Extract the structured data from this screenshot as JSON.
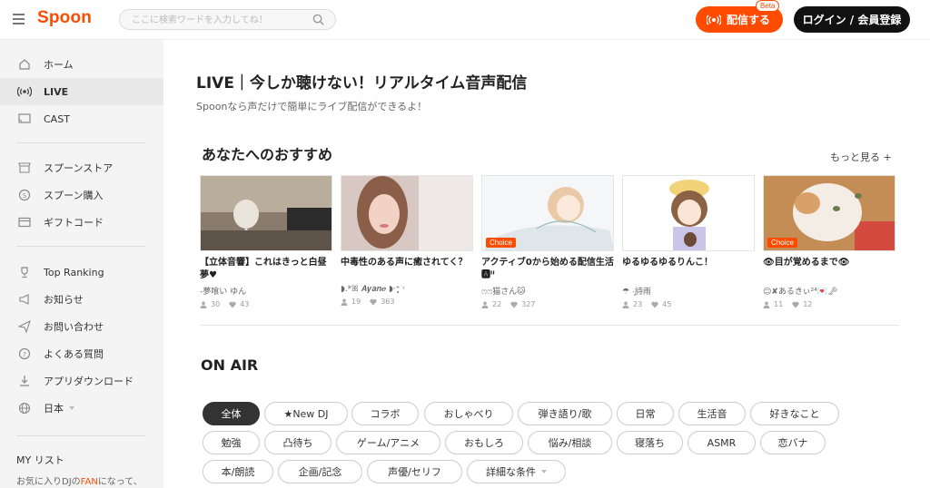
{
  "header": {
    "logo": "Spoon",
    "search_placeholder": "ここに検索ワードを入力してね！",
    "live_button": "配信する",
    "beta_badge": "Beta",
    "login_button": "ログイン / 会員登録"
  },
  "sidebar": {
    "items": [
      {
        "label": "ホーム",
        "icon": "home-icon"
      },
      {
        "label": "LIVE",
        "icon": "live-broadcast-icon",
        "active": true
      },
      {
        "label": "CAST",
        "icon": "cast-icon"
      },
      {
        "label": "スプーンストア",
        "icon": "store-icon"
      },
      {
        "label": "スプーン購入",
        "icon": "coin-icon"
      },
      {
        "label": "ギフトコード",
        "icon": "card-icon"
      },
      {
        "label": "Top Ranking",
        "icon": "trophy-icon"
      },
      {
        "label": "お知らせ",
        "icon": "megaphone-icon"
      },
      {
        "label": "お問い合わせ",
        "icon": "send-icon"
      },
      {
        "label": "よくある質問",
        "icon": "question-icon"
      },
      {
        "label": "アプリダウンロード",
        "icon": "download-icon"
      },
      {
        "label": "日本",
        "icon": "globe-icon"
      }
    ],
    "my_list_title": "MY リスト",
    "my_list_desc_before": "お気に入りDJの",
    "my_list_desc_fan": "FAN",
    "my_list_desc_after": "になって、"
  },
  "main": {
    "title": "LIVE｜今しか聴けない！リアルタイム音声配信",
    "subtitle": "Spoonなら声だけで簡単にライブ配信ができるよ！",
    "recommend_title": "あなたへのおすすめ",
    "more_link": "もっと見る +",
    "cards": [
      {
        "title": "【立体音響】これはきっと白昼夢♥",
        "dj": "-夢喰い ゆん",
        "listeners": "30",
        "likes": "43",
        "choice": false
      },
      {
        "title": "中毒性のある声に癒されてく？",
        "dj": "◗.*ꕤ 𝑨𝒚𝒂𝒏𝒆 ◗·⁺̣̥̣ ˒",
        "listeners": "19",
        "likes": "363",
        "choice": false
      },
      {
        "title": "アクティブ0から始める配信生活🅰ᴵᴵ",
        "dj": "ෆෆ猫さん🐱",
        "listeners": "22",
        "likes": "327",
        "choice": true
      },
      {
        "title": "ゆるゆるゆるりんこ！",
        "dj": "☂︎ ·̩͙詩雨",
        "listeners": "23",
        "likes": "45",
        "choice": false
      },
      {
        "title": "👁目が覚めるまで👁",
        "dj": "☺︎✘あるきぃ²⁴💌🗝",
        "listeners": "11",
        "likes": "12",
        "choice": true
      }
    ],
    "choice_label": "Choice",
    "onair_title": "ON AIR",
    "categories": [
      "全体",
      "★New DJ",
      "コラボ",
      "おしゃべり",
      "弾き語り/歌",
      "日常",
      "生活音",
      "好きなこと",
      "勉強",
      "凸待ち",
      "ゲーム/アニメ",
      "おもしろ",
      "悩み/相談",
      "寝落ち",
      "ASMR",
      "恋バナ",
      "本/朗読",
      "企画/記念",
      "声優/セリフ",
      "詳細な条件"
    ]
  },
  "colors": {
    "accent": "#ff4b00",
    "login_bg": "#111111",
    "sidebar_bg": "#f4f4f4"
  }
}
